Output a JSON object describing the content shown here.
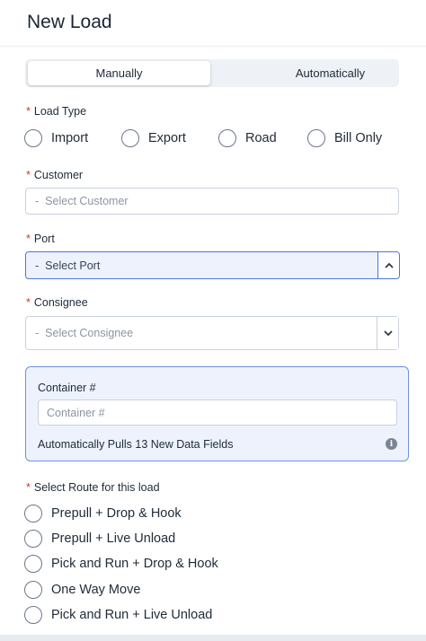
{
  "header": {
    "title": "New Load"
  },
  "mode_tabs": [
    {
      "label": "Manually",
      "active": true
    },
    {
      "label": "Automatically",
      "active": false
    }
  ],
  "load_type": {
    "required_mark": "*",
    "label": "Load Type",
    "options": [
      "Import",
      "Export",
      "Road",
      "Bill Only"
    ]
  },
  "customer": {
    "required_mark": "*",
    "label": "Customer",
    "dash": "-",
    "placeholder": "Select Customer"
  },
  "port": {
    "required_mark": "*",
    "label": "Port",
    "dash": "-",
    "placeholder": "Select Port",
    "state": "open"
  },
  "consignee": {
    "required_mark": "*",
    "label": "Consignee",
    "dash": "-",
    "placeholder": "Select Consignee"
  },
  "container": {
    "label": "Container #",
    "placeholder": "Container #",
    "note": "Automatically Pulls 13 New Data Fields",
    "info_icon": "info-icon",
    "info_glyph": "i"
  },
  "route": {
    "required_mark": "*",
    "label": "Select Route for this load",
    "options": [
      "Prepull + Drop & Hook",
      "Prepull + Live Unload",
      "Pick and Run + Drop & Hook",
      "One Way Move",
      "Pick and Run + Live Unload"
    ]
  },
  "colors": {
    "accent": "#4d77d6",
    "required": "#e03131",
    "highlight_bg": "#edf2fd"
  }
}
